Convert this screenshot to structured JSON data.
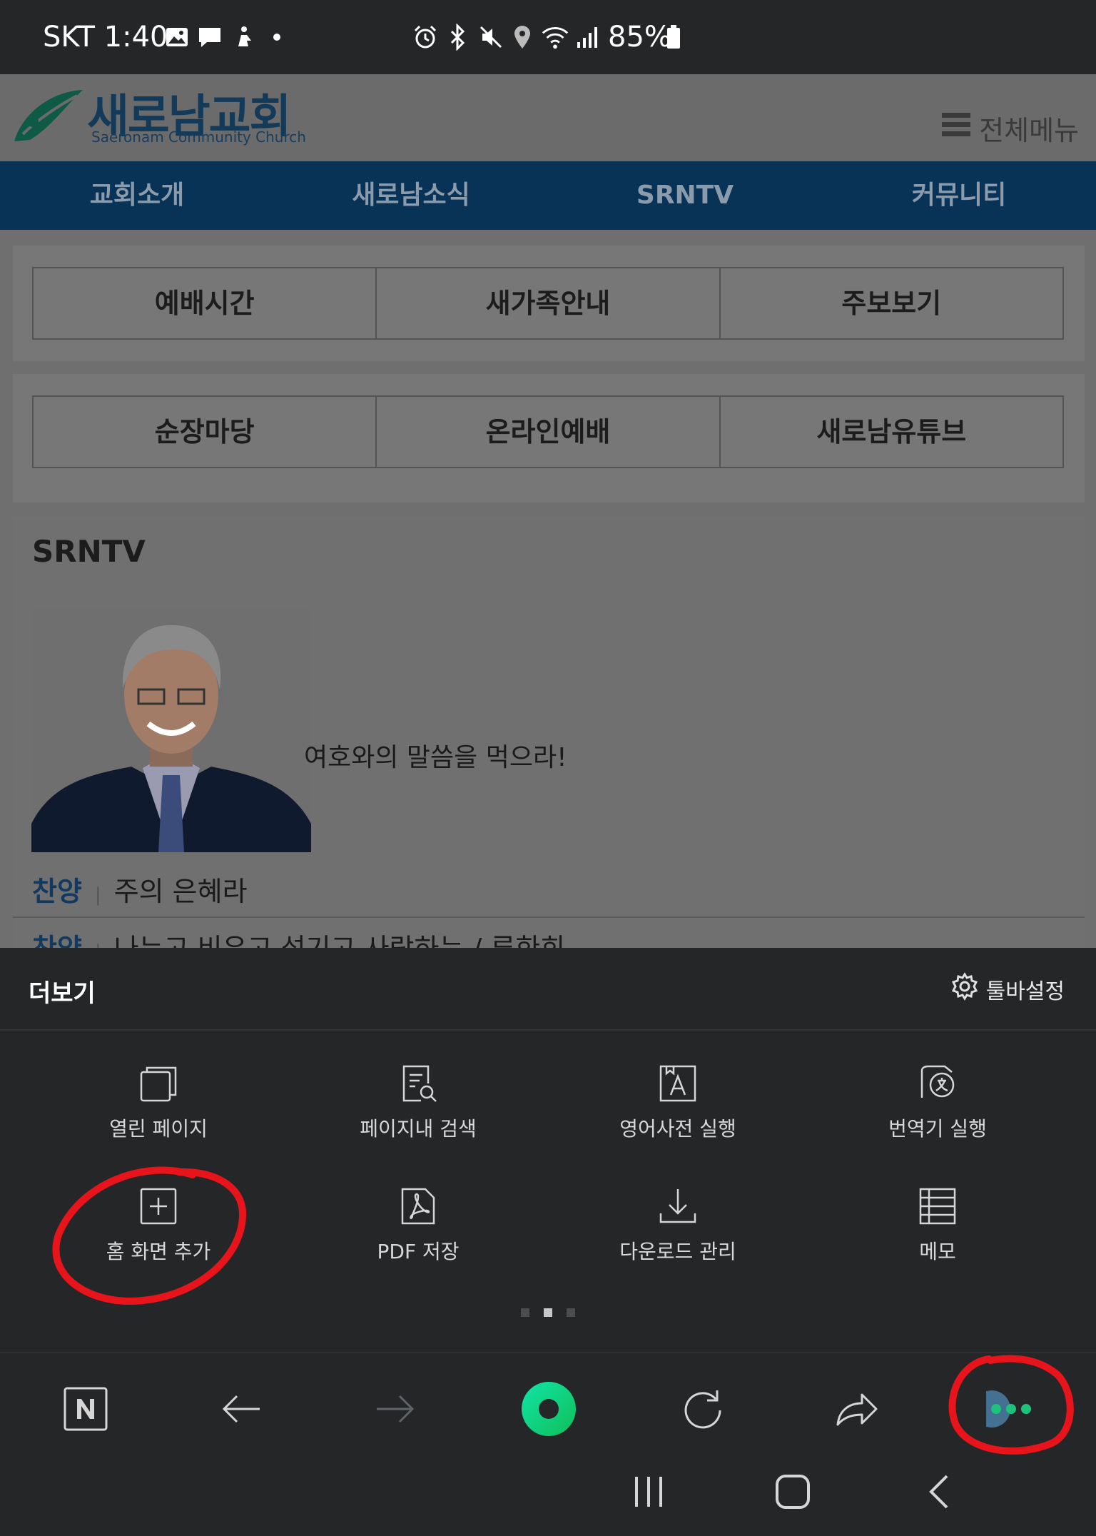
{
  "status_bar": {
    "carrier_time": "SKT 1:40",
    "battery": "85%"
  },
  "site": {
    "logo_ko": "새로남교회",
    "logo_en": "Saeronam Community Church",
    "menu_label": "전체메뉴",
    "nav": [
      "교회소개",
      "새로남소식",
      "SRNTV",
      "커뮤니티"
    ],
    "quick_row1": [
      "예배시간",
      "새가족안내",
      "주보보기"
    ],
    "quick_row2": [
      "순장마당",
      "온라인예배",
      "새로남유튜브"
    ],
    "srntv": {
      "title": "SRNTV",
      "sermon_title": "여호와의 말씀을 먹으라!",
      "items": [
        {
          "category": "찬양",
          "title": "주의 은혜라"
        },
        {
          "category": "찬양",
          "title": "나누고 비우고 섬기고 사랑하는 / 류한희"
        }
      ]
    }
  },
  "sheet": {
    "title": "더보기",
    "toolbar_settings": "툴바설정",
    "tiles": [
      {
        "label": "열린 페이지",
        "icon": "tabs-icon"
      },
      {
        "label": "페이지내 검색",
        "icon": "find-in-page-icon"
      },
      {
        "label": "영어사전 실행",
        "icon": "dictionary-icon"
      },
      {
        "label": "번역기 실행",
        "icon": "translator-icon"
      },
      {
        "label": "홈 화면 추가",
        "icon": "add-to-home-icon"
      },
      {
        "label": "PDF 저장",
        "icon": "pdf-icon"
      },
      {
        "label": "다운로드 관리",
        "icon": "download-icon"
      },
      {
        "label": "메모",
        "icon": "memo-icon"
      }
    ],
    "page_indicator": {
      "pages": 3,
      "current": 2
    }
  },
  "bottom_toolbar": [
    "naver-home-icon",
    "back-arrow-icon",
    "forward-arrow-icon",
    "green-dot-icon",
    "refresh-icon",
    "share-icon",
    "more-icon"
  ],
  "colors": {
    "accent_green": "#1ec27a",
    "nav_blue": "#093257",
    "annotation_red": "#e8141c"
  }
}
